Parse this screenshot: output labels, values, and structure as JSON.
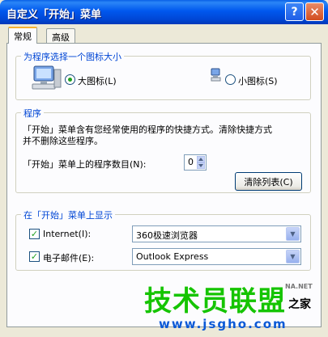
{
  "window": {
    "title": "自定义「开始」菜单",
    "help_glyph": "?",
    "close_glyph": "✕"
  },
  "tabs": [
    {
      "label": "常规",
      "active": true
    },
    {
      "label": "高级",
      "active": false
    }
  ],
  "icon_size_group": {
    "label": "为程序选择一个图标大小",
    "large_label": "大图标(L)",
    "small_label": "小图标(S)",
    "selected": "large",
    "large_icon": "large-computer-icon",
    "small_icon": "small-computer-icon"
  },
  "programs_group": {
    "label": "程序",
    "description_line1": "「开始」菜单含有您经常使用的程序的快捷方式。清除快捷方式",
    "description_line2": "并不删除这些程序。",
    "count_label": "「开始」菜单上的程序数目(N):",
    "count_value": "0",
    "clear_button": "清除列表(C)"
  },
  "show_group": {
    "label": "在「开始」菜单上显示",
    "internet_label": "Internet(I):",
    "internet_checked": true,
    "internet_value": "360极速浏览器",
    "email_label": "电子邮件(E):",
    "email_checked": true,
    "email_value": "Outlook Express"
  },
  "watermark": {
    "brand": "技术员联盟",
    "url": "www.jsgho.com",
    "suffix": "之家",
    "net": "NA.NET"
  },
  "colors": {
    "titlebar": "#0058ee",
    "group_label": "#0046d5",
    "watermark_green": "#15c400",
    "watermark_blue": "#0b59d6"
  }
}
